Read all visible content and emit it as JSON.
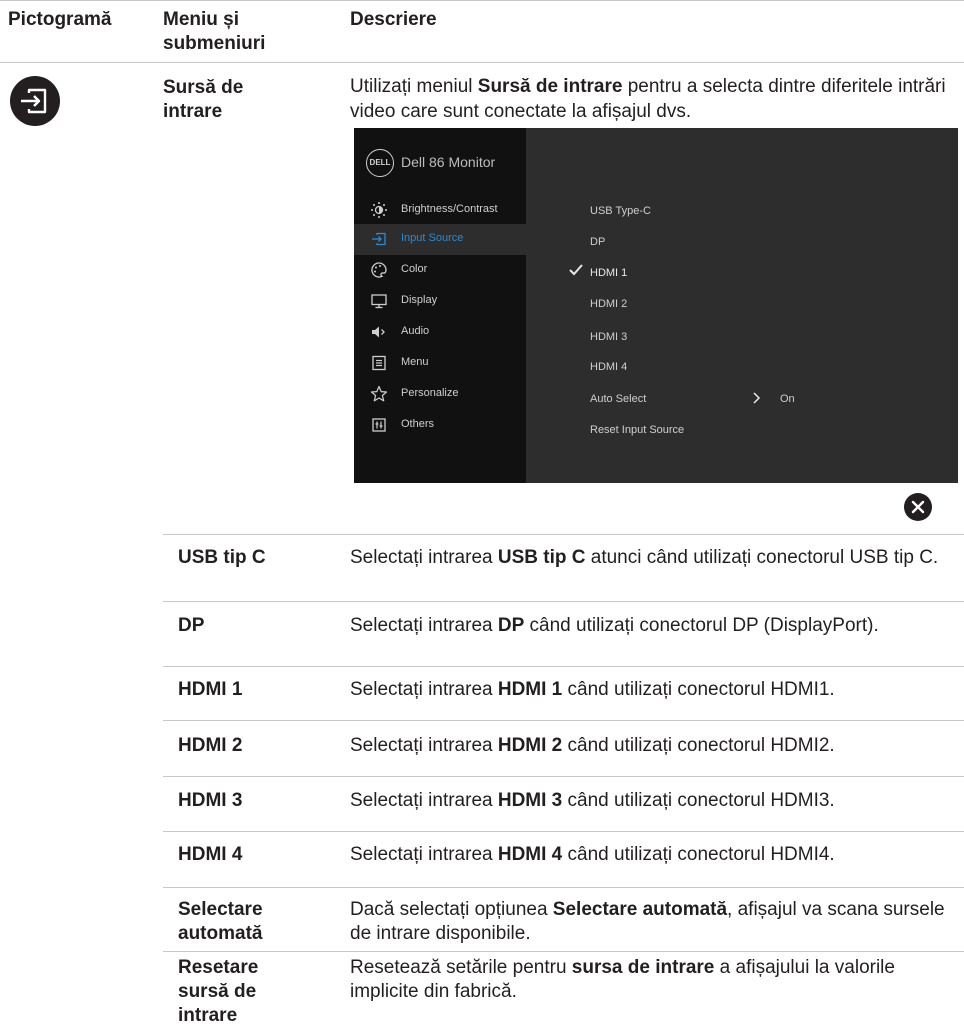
{
  "table": {
    "headers": {
      "icon": "Pictogramă",
      "menu": "Meniu și submeniuri",
      "description": "Descriere"
    }
  },
  "section": {
    "icon": "input-source-icon",
    "name": "Sursă de intrare",
    "intro": {
      "before": "Utilizați meniul ",
      "bold": "Sursă de intrare",
      "after": " pentru a selecta dintre diferitele intrări video care sunt conectate la afișajul dvs."
    }
  },
  "osd": {
    "title": "Dell 86 Monitor",
    "logo": "DELL",
    "menu": [
      {
        "label": "Brightness/Contrast",
        "icon": "brightness-icon",
        "active": false
      },
      {
        "label": "Input Source",
        "icon": "input-source-icon",
        "active": true
      },
      {
        "label": "Color",
        "icon": "palette-icon",
        "active": false
      },
      {
        "label": "Display",
        "icon": "monitor-icon",
        "active": false
      },
      {
        "label": "Audio",
        "icon": "speaker-icon",
        "active": false
      },
      {
        "label": "Menu",
        "icon": "menu-list-icon",
        "active": false
      },
      {
        "label": "Personalize",
        "icon": "star-icon",
        "active": false
      },
      {
        "label": "Others",
        "icon": "others-icon",
        "active": false
      }
    ],
    "options": [
      "USB Type-C",
      "DP",
      "HDMI 1",
      "HDMI 2",
      "HDMI 3",
      "HDMI 4",
      "Auto Select",
      "Reset Input Source"
    ],
    "selected": "HDMI 1",
    "auto_select_value": "On",
    "colors": {
      "accent": "#2b8ad6",
      "panel": "#2d2d2d",
      "sidebar": "#111111"
    }
  },
  "close_icon": "close-icon",
  "rows": [
    {
      "label": "USB tip C",
      "before": "Selectați intrarea ",
      "bold": "USB tip C",
      "after": " atunci când utilizați conectorul USB tip C."
    },
    {
      "label": "DP",
      "before": "Selectați intrarea ",
      "bold": "DP",
      "after": " când utilizați conectorul DP (DisplayPort)."
    },
    {
      "label": "HDMI 1",
      "before": "Selectați intrarea ",
      "bold": "HDMI 1",
      "after": " când utilizați conectorul HDMI1."
    },
    {
      "label": "HDMI 2",
      "before": "Selectați intrarea ",
      "bold": "HDMI 2",
      "after": " când utilizați conectorul HDMI2."
    },
    {
      "label": "HDMI 3",
      "before": "Selectați intrarea ",
      "bold": "HDMI 3",
      "after": " când utilizați conectorul HDMI3."
    },
    {
      "label": "HDMI 4",
      "before": "Selectați intrarea ",
      "bold": "HDMI 4",
      "after": " când utilizați conectorul HDMI4."
    },
    {
      "label": "Selectare automată",
      "before": "Dacă selectați opțiunea ",
      "bold": "Selectare automată",
      "after": ", afișajul va scana sursele de intrare disponibile."
    },
    {
      "label": "Resetare sursă de intrare",
      "before": "Resetează setările pentru ",
      "bold": "sursa de intrare",
      "after": " a afișajului la valorile implicite din fabrică."
    }
  ]
}
